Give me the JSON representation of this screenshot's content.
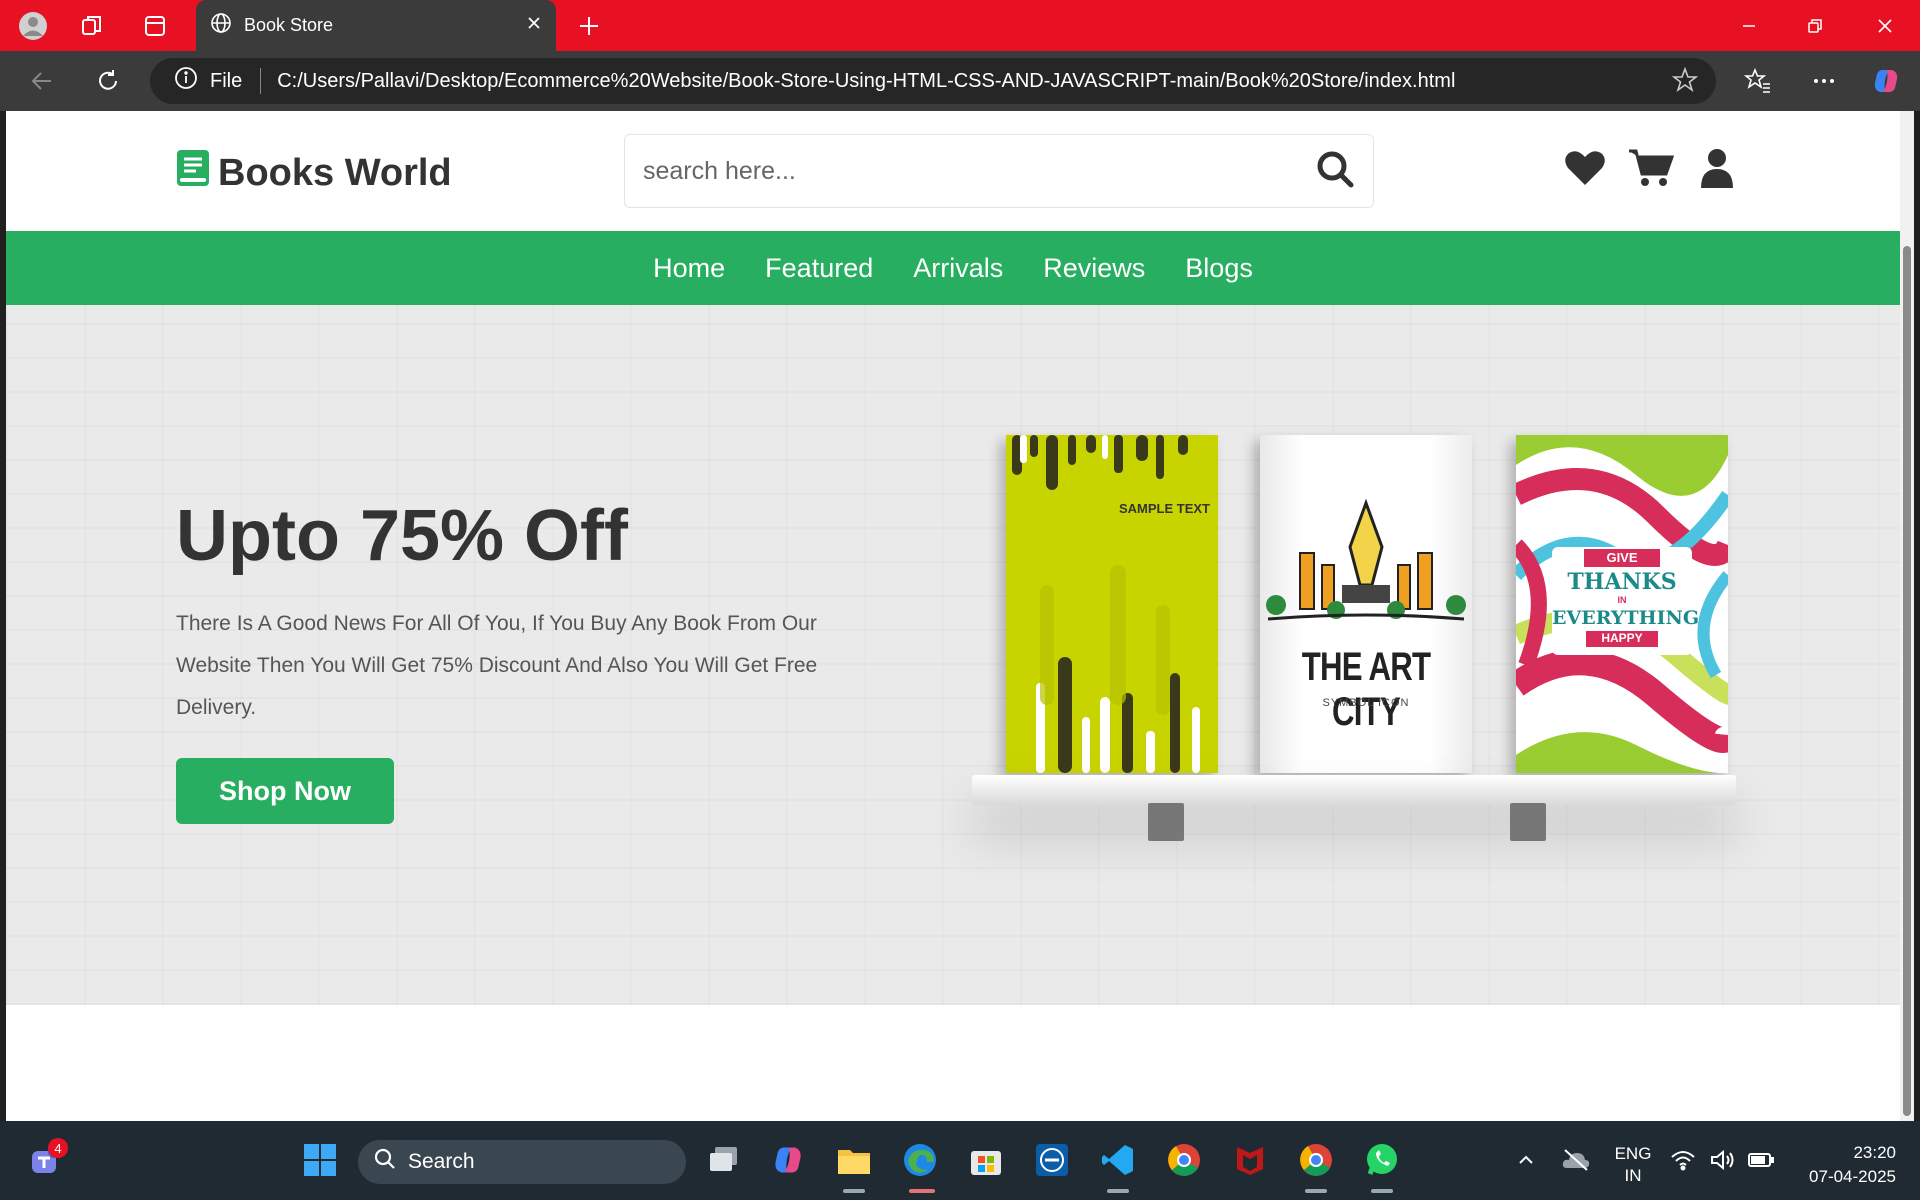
{
  "browser": {
    "tab_title": "Book Store",
    "address_prefix": "File",
    "url": "C:/Users/Pallavi/Desktop/Ecommerce%20Website/Book-Store-Using-HTML-CSS-AND-JAVASCRIPT-main/Book%20Store/index.html",
    "accent_color": "#e81123"
  },
  "site": {
    "logo_text": "Books World",
    "search_placeholder": "search here...",
    "header_icons": [
      "heart-icon",
      "cart-icon",
      "user-icon"
    ],
    "nav": [
      {
        "label": "Home"
      },
      {
        "label": "Featured"
      },
      {
        "label": "Arrivals"
      },
      {
        "label": "Reviews"
      },
      {
        "label": "Blogs"
      }
    ],
    "brand_color": "#27ae60"
  },
  "hero": {
    "title": "Upto 75% Off",
    "text": "There Is A Good News For All Of You, If You Buy Any Book From Our Website Then You Will Get 75% Discount And Also You Will Get Free Delivery.",
    "cta": "Shop Now",
    "books": [
      {
        "name": "book-sample-text",
        "cover_text": "SAMPLE TEXT"
      },
      {
        "name": "book-art-city",
        "cover_text": "THE ART CITY",
        "subtitle": "SYMBOL ICON"
      },
      {
        "name": "book-give-thanks",
        "cover_lines": [
          "GIVE",
          "THANKS",
          "IN",
          "EVERYTHING",
          "HAPPY"
        ]
      }
    ]
  },
  "taskbar": {
    "search_label": "Search",
    "notification_count": "4",
    "language": "ENG",
    "region": "IN",
    "time": "23:20",
    "date": "07-04-2025"
  }
}
